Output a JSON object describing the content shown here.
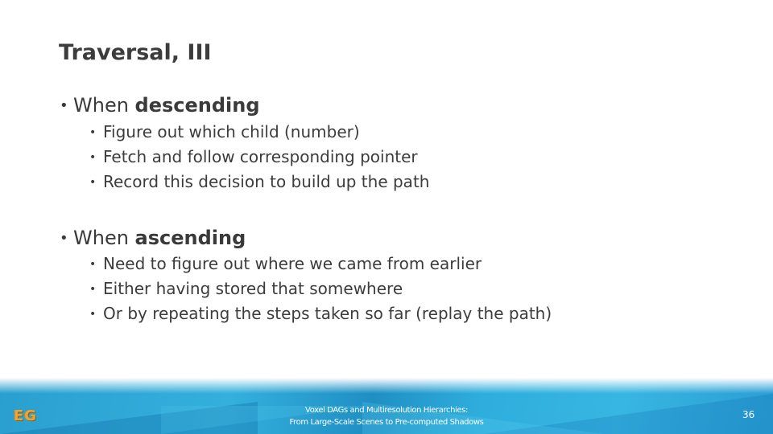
{
  "slide": {
    "title": "Traversal, III",
    "sections": [
      {
        "lead": "When ",
        "emphasis": "descending",
        "items": [
          "Figure out which child (number)",
          "Fetch and follow corresponding pointer",
          "Record this decision to build up the path"
        ]
      },
      {
        "lead": "When ",
        "emphasis": "ascending",
        "items": [
          "Need to figure out where we came from earlier",
          "Either having stored that somewhere",
          "Or by repeating the steps taken so far (replay the path)"
        ]
      }
    ],
    "bullet_glyph": "•"
  },
  "footer": {
    "logo_text": "EG",
    "line1": "Voxel DAGs and Multiresolution Hierarchies:",
    "line2": "From Large-Scale Scenes to Pre-computed Shadows",
    "page_number": "36",
    "colors": {
      "band": "#2eaedd",
      "logo": "#e9a53a",
      "text": "#ffffff"
    }
  }
}
